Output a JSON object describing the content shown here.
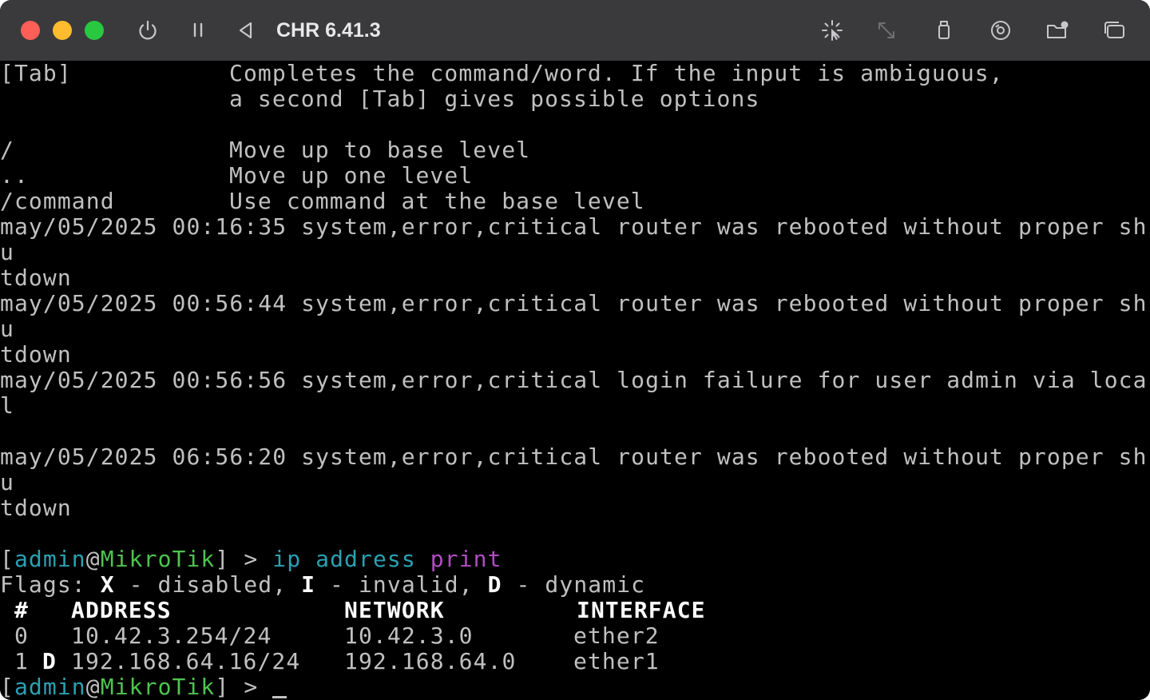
{
  "window": {
    "title": "CHR 6.41.3",
    "colors": {
      "titlebar": "#3a3a3c",
      "close": "#ff5f57",
      "minimize": "#febc2e",
      "maximize": "#28c840"
    },
    "toolbar_icons": [
      "power-icon",
      "pause-icon",
      "back-icon",
      "capture-input-icon",
      "resize-icon",
      "usb-icon",
      "disk-icon",
      "shared-folder-icon",
      "windows-icon"
    ]
  },
  "terminal": {
    "help": [
      {
        "key": "[Tab]",
        "desc": "Completes the command/word. If the input is ambiguous,"
      },
      {
        "key": "",
        "desc": "a second [Tab] gives possible options"
      },
      {
        "key": "/",
        "desc": "Move up to base level"
      },
      {
        "key": "..",
        "desc": "Move up one level"
      },
      {
        "key": "/command",
        "desc": "Use command at the base level"
      }
    ],
    "logs": [
      {
        "line1": "may/05/2025 00:16:35 system,error,critical router was rebooted without proper sh",
        "line2": "u",
        "line3": "tdown"
      },
      {
        "line1": "may/05/2025 00:56:44 system,error,critical router was rebooted without proper sh",
        "line2": "u",
        "line3": "tdown"
      },
      {
        "line1": "may/05/2025 00:56:56 system,error,critical login failure for user admin via loca",
        "line2": "l",
        "line3": ""
      },
      {
        "line1": "may/05/2025 06:56:20 system,error,critical router was rebooted without proper sh",
        "line2": "u",
        "line3": "tdown"
      }
    ],
    "prompt": {
      "open": "[",
      "user": "admin",
      "at": "@",
      "host": "MikroTik",
      "close": "] > "
    },
    "command": {
      "part1": "ip address",
      "part2": "print"
    },
    "flags": {
      "label": "Flags: ",
      "x": "X",
      "x_desc": " - disabled, ",
      "i": "I",
      "i_desc": " - invalid, ",
      "d": "D",
      "d_desc": " - dynamic"
    },
    "table": {
      "headers": {
        "num": " #",
        "address": "ADDRESS",
        "network": "NETWORK",
        "interface": "INTERFACE"
      },
      "rows": [
        {
          "num": " 0",
          "flag": "",
          "address": "10.42.3.254/24",
          "network": "10.42.3.0",
          "interface": "ether2"
        },
        {
          "num": " 1",
          "flag": "D",
          "address": "192.168.64.16/24",
          "network": "192.168.64.0",
          "interface": "ether1"
        }
      ]
    },
    "colors": {
      "text": "#c0c0c0",
      "bold": "#ffffff",
      "user": "#2aa1b3",
      "host": "#4ec44e",
      "print": "#b04ec0"
    }
  }
}
